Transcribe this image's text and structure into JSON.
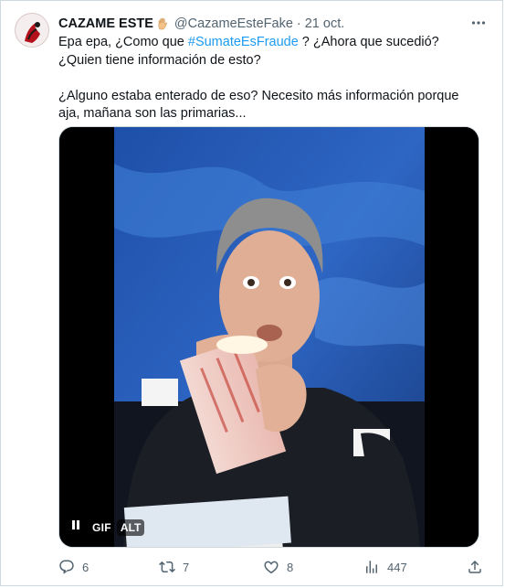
{
  "tweet": {
    "display_name": "CAZAME ESTE",
    "badge_icon": "raised-hand-emoji",
    "handle": "@CazameEsteFake",
    "separator": "·",
    "date": "21 oct.",
    "text_line1_prefix": "Epa epa,  ¿Como que ",
    "hashtag": "#SumateEsFraude",
    "text_line1_suffix": " ? ¿Ahora que sucedió? ¿Quien tiene información de esto?",
    "text_paragraph2": "¿Alguno estaba enterado de eso? Necesito más información porque aja, mañana son las primarias..."
  },
  "media": {
    "type": "gif",
    "gif_label": "GIF",
    "alt_label": "ALT"
  },
  "actions": {
    "replies": "6",
    "retweets": "7",
    "likes": "8",
    "views": "447"
  },
  "colors": {
    "text": "#0f1419",
    "secondary": "#536471",
    "accent": "#1d9bf0",
    "border": "#cfd9de"
  }
}
